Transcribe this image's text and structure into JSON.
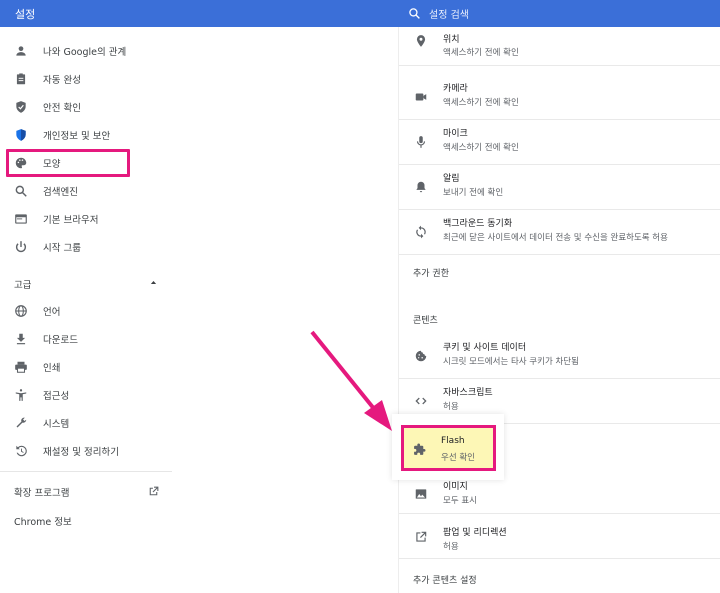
{
  "header": {
    "title": "설정",
    "search_placeholder": "설정 검색"
  },
  "sidebar": {
    "items": [
      {
        "label": "나와 Google의 관계",
        "icon": "person-icon"
      },
      {
        "label": "자동 완성",
        "icon": "clipboard-icon"
      },
      {
        "label": "안전 확인",
        "icon": "shield-check-icon"
      },
      {
        "label": "개인정보 및 보안",
        "icon": "shield-icon"
      },
      {
        "label": "모양",
        "icon": "palette-icon"
      },
      {
        "label": "검색엔진",
        "icon": "search-icon"
      },
      {
        "label": "기본 브라우저",
        "icon": "browser-icon"
      },
      {
        "label": "시작 그룹",
        "icon": "power-icon"
      }
    ],
    "advanced_label": "고급",
    "advanced_items": [
      {
        "label": "언어",
        "icon": "globe-icon"
      },
      {
        "label": "다운로드",
        "icon": "download-icon"
      },
      {
        "label": "인쇄",
        "icon": "printer-icon"
      },
      {
        "label": "접근성",
        "icon": "accessibility-icon"
      },
      {
        "label": "시스템",
        "icon": "wrench-icon"
      },
      {
        "label": "재설정 및 정리하기",
        "icon": "history-icon"
      }
    ],
    "extensions_label": "확장 프로그램",
    "about_label": "Chrome 정보"
  },
  "permissions": {
    "items": [
      {
        "title": "위치",
        "sub": "액세스하기 전에 확인",
        "icon": "location-icon"
      },
      {
        "title": "카메라",
        "sub": "액세스하기 전에 확인",
        "icon": "camera-icon"
      },
      {
        "title": "마이크",
        "sub": "액세스하기 전에 확인",
        "icon": "microphone-icon"
      },
      {
        "title": "알림",
        "sub": "보내기 전에 확인",
        "icon": "bell-icon"
      },
      {
        "title": "백그라운드 동기화",
        "sub": "최근에 닫은 사이트에서 데이터 전송 및 수신을 완료하도록 허용",
        "icon": "sync-icon"
      }
    ],
    "additional_label": "추가 권한"
  },
  "content": {
    "heading": "콘텐츠",
    "items": [
      {
        "title": "쿠키 및 사이트 데이터",
        "sub": "시크릿 모드에서는 타사 쿠키가 차단됨",
        "icon": "cookie-icon"
      },
      {
        "title": "자바스크립트",
        "sub": "허용",
        "icon": "code-icon"
      },
      {
        "title": "Flash",
        "sub": "우선 확인",
        "icon": "puzzle-icon"
      },
      {
        "title": "이미지",
        "sub": "모두 표시",
        "icon": "image-icon"
      },
      {
        "title": "팝업 및 리디렉션",
        "sub": "허용",
        "icon": "open-in-new-icon"
      }
    ],
    "additional_label": "추가 콘텐츠 설정"
  },
  "colors": {
    "header_blue": "#3b6fd8",
    "highlight_pink": "#e5197e",
    "flash_bg": "#fdf7b6"
  }
}
